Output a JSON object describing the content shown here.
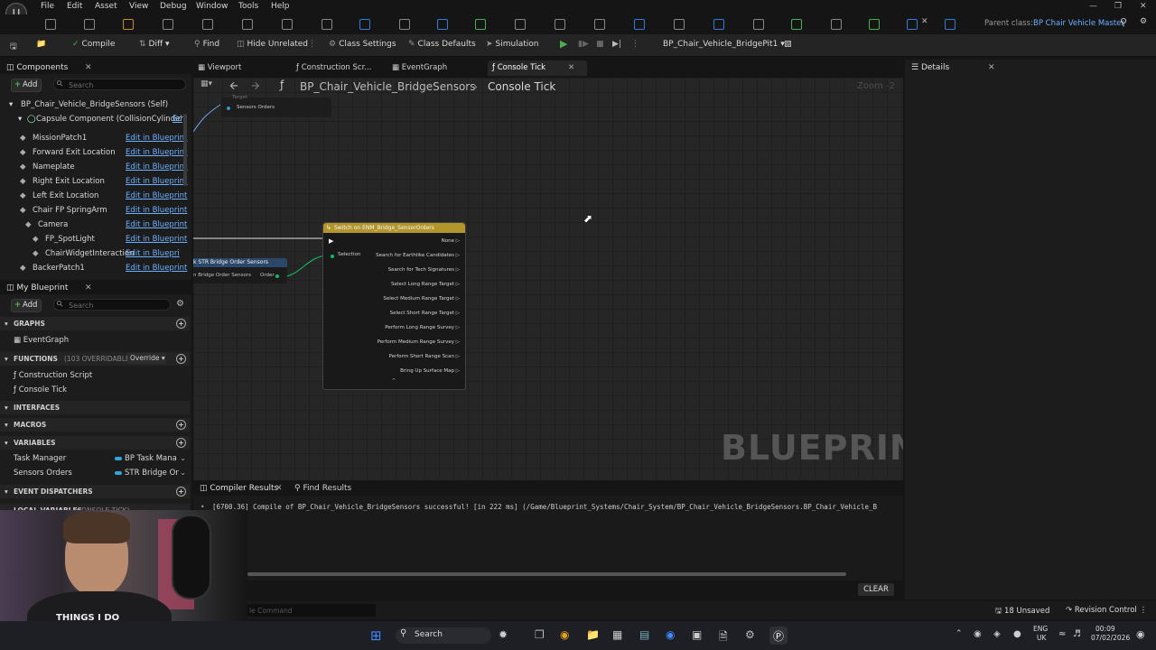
{
  "menu": {
    "items": [
      "File",
      "Edit",
      "Asset",
      "View",
      "Debug",
      "Window",
      "Tools",
      "Help"
    ],
    "parent_class_label": "Parent class:",
    "parent_class_value": "BP Chair Vehicle Master"
  },
  "toolbar": {
    "compile": "Compile",
    "diff": "Diff",
    "find": "Find",
    "hide_unrelated": "Hide Unrelated",
    "class_settings": "Class Settings",
    "class_defaults": "Class Defaults",
    "simulation": "Simulation",
    "debug_object": "BP_Chair_Vehicle_BridgePit1"
  },
  "components": {
    "title": "Components",
    "add": "Add",
    "search_placeholder": "Search",
    "self": "BP_Chair_Vehicle_BridgeSensors (Self)",
    "root": "Capsule Component (CollisionCylinder)",
    "root_edit": "Ed",
    "edit_label": "Edit in Blueprint",
    "edit_label_short": "Edit in Bluepri",
    "items": [
      "MissionPatch1",
      "Forward Exit Location",
      "Nameplate",
      "Right Exit Location",
      "Left Exit Location",
      "Chair FP SpringArm",
      "Camera",
      "FP_SpotLight",
      "ChairWidgetInteraction",
      "BackerPatch1"
    ]
  },
  "my_blueprint": {
    "title": "My Blueprint",
    "add": "Add",
    "search_placeholder": "Search",
    "graphs_header": "GRAPHS",
    "event_graph": "EventGraph",
    "functions_header": "FUNCTIONS",
    "functions_overridable": "(103 OVERRIDABLE)",
    "override": "Override",
    "construction_script": "Construction Script",
    "console_tick": "Console Tick",
    "interfaces_header": "INTERFACES",
    "macros_header": "MACROS",
    "variables_header": "VARIABLES",
    "variables": [
      {
        "name": "Task Manager",
        "type": "BP Task Mana",
        "color": "#2fa6e0"
      },
      {
        "name": "Sensors Orders",
        "type": "STR Bridge Or",
        "color": "#2fa6e0"
      }
    ],
    "event_dispatchers_header": "EVENT DISPATCHERS",
    "local_variables_header": "LOCAL VARIABLES",
    "local_variables_sub": "(CONSOLE TICK)"
  },
  "graph_tabs": {
    "viewport": "Viewport",
    "construction": "Construction Scr...",
    "event_graph": "EventGraph",
    "console_tick": "Console Tick"
  },
  "graph": {
    "breadcrumb_bp": "BP_Chair_Vehicle_BridgeSensors",
    "breadcrumb_fn": "Console Tick",
    "zoom": "Zoom -2",
    "watermark": "BLUEPRINT",
    "small_node_target": "Target",
    "small_node_pin": "Sensors Orders",
    "break_node_title": "k STR Bridge Order Sensors",
    "break_node_in": "n Bridge Order Sensors",
    "break_node_out": "Order",
    "switch_title": "Switch on ENM_Bridge_SensorOrders",
    "selection": "Selection",
    "outputs": [
      "None",
      "Search for Earthlike Candidates",
      "Search for Tech Signatures",
      "Select Long Range Target",
      "Select Medium Range Target",
      "Select Short Range Target",
      "Perform Long Range Survey",
      "Perform Medium Range Survey",
      "Perform Short Range Scan",
      "Bring Up Surface Map"
    ]
  },
  "bottom": {
    "compiler_results": "Compiler Results",
    "find_results": "Find Results",
    "log": "[6700.36] Compile of BP_Chair_Vehicle_BridgeSensors successful! [in 222 ms] (/Game/Blueprint_Systems/Chair_System/BP_Chair_Vehicle_BridgeSensors.BP_Chair_Vehicle_B",
    "clear": "CLEAR",
    "console_placeholder": "le Command"
  },
  "details": {
    "title": "Details"
  },
  "status": {
    "unsaved": "18 Unsaved",
    "revision_control": "Revision Control"
  },
  "taskbar": {
    "search": "Search",
    "lang": "ENG",
    "region": "UK",
    "time": "00:09",
    "date": "07/02/2026"
  },
  "webcam": {
    "shirt_text": "THINGS I DO"
  }
}
